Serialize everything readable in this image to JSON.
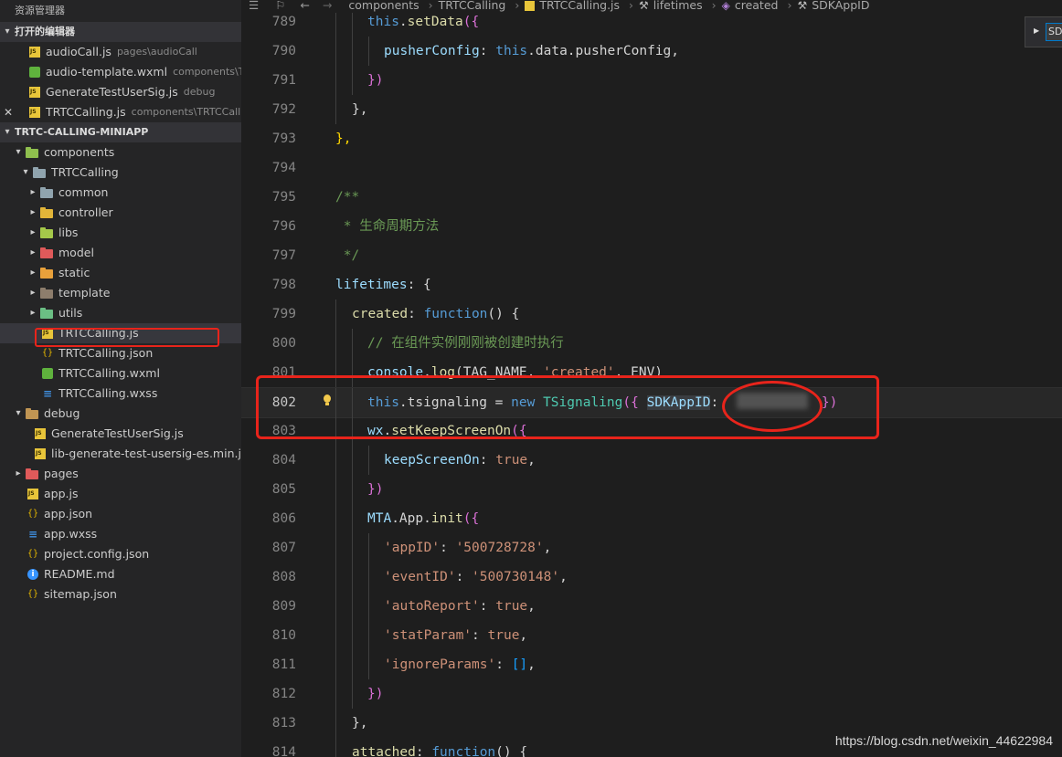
{
  "explorer": {
    "title": "资源管理器",
    "open_editors_label": "打开的编辑器",
    "open_editors": [
      {
        "name": "audioCall.js",
        "desc": "pages\\audioCall",
        "icon": "js-file-icon"
      },
      {
        "name": "audio-template.wxml",
        "desc": "components\\T...",
        "icon": "wxml-file-icon"
      },
      {
        "name": "GenerateTestUserSig.js",
        "desc": "debug",
        "icon": "js-file-icon"
      },
      {
        "name": "TRTCCalling.js",
        "desc": "components\\TRTCCalli...",
        "icon": "js-file-icon"
      }
    ],
    "close_glyph": "✕",
    "project_label": "TRTC-CALLING-MINIAPP",
    "tree": {
      "components": "components",
      "trtccalling": "TRTCCalling",
      "common": "common",
      "controller": "controller",
      "libs": "libs",
      "model": "model",
      "static": "static",
      "template": "template",
      "utils": "utils",
      "trtc_js": "TRTCCalling.js",
      "trtc_json": "TRTCCalling.json",
      "trtc_wxml": "TRTCCalling.wxml",
      "trtc_wxss": "TRTCCalling.wxss",
      "debug": "debug",
      "gen_sig": "GenerateTestUserSig.js",
      "lib_gen": "lib-generate-test-usersig-es.min.js",
      "pages": "pages",
      "app_js": "app.js",
      "app_json": "app.json",
      "app_wxss": "app.wxss",
      "project_config": "project.config.json",
      "readme": "README.md",
      "sitemap": "sitemap.json"
    }
  },
  "breadcrumb": {
    "items": [
      "components",
      "TRTCCalling",
      "TRTCCalling.js",
      "lifetimes",
      "created",
      "SDKAppID"
    ]
  },
  "find_widget": {
    "value": "SDK"
  },
  "editor": {
    "line_numbers": [
      "789",
      "790",
      "791",
      "792",
      "793",
      "794",
      "795",
      "796",
      "797",
      "798",
      "799",
      "800",
      "801",
      "802",
      "803",
      "804",
      "805",
      "806",
      "807",
      "808",
      "809",
      "810",
      "811",
      "812",
      "813",
      "814"
    ],
    "code": {
      "l789_a": "this",
      "l789_b": ".",
      "l789_c": "setData",
      "l789_d": "({",
      "l790_a": "pusherConfig",
      "l790_b": ": ",
      "l790_c": "this",
      "l790_d": ".data.pusherConfig,",
      "l791": "})",
      "l792": "},",
      "l793": "},",
      "l795": "/**",
      "l796": " * 生命周期方法",
      "l797": " */",
      "l798_a": "lifetimes",
      "l798_b": ": {",
      "l799_a": "created",
      "l799_b": ": ",
      "l799_c": "function",
      "l799_d": "() {",
      "l800": "// 在组件实例刚刚被创建时执行",
      "l801_a": "console",
      "l801_b": ".",
      "l801_c": "log",
      "l801_d": "(TAG_NAME, ",
      "l801_e": "'created'",
      "l801_f": ", ENV)",
      "l802_a": "this",
      "l802_b": ".tsignaling = ",
      "l802_c": "new",
      "l802_d": " ",
      "l802_e": "TSignaling",
      "l802_f": "({ ",
      "l802_g": "SDKAppID",
      "l802_h": ": ",
      "l802_i": "})",
      "l803_a": "wx",
      "l803_b": ".",
      "l803_c": "setKeepScreenOn",
      "l803_d": "({",
      "l804_a": "keepScreenOn",
      "l804_b": ": ",
      "l804_c": "true",
      "l804_d": ",",
      "l805": "})",
      "l806_a": "MTA",
      "l806_b": ".App.",
      "l806_c": "init",
      "l806_d": "({",
      "l807_a": "'appID'",
      "l807_b": ": ",
      "l807_c": "'500728728'",
      "l807_d": ",",
      "l808_a": "'eventID'",
      "l808_b": ": ",
      "l808_c": "'500730148'",
      "l808_d": ",",
      "l809_a": "'autoReport'",
      "l809_b": ": ",
      "l809_c": "true",
      "l809_d": ",",
      "l810_a": "'statParam'",
      "l810_b": ": ",
      "l810_c": "true",
      "l810_d": ",",
      "l811_a": "'ignoreParams'",
      "l811_b": ": ",
      "l811_c": "[]",
      "l811_d": ",",
      "l812": "})",
      "l813": "},",
      "l814_a": "attached",
      "l814_b": ": ",
      "l814_c": "function",
      "l814_d": "() {"
    }
  },
  "watermark": "https://blog.csdn.net/weixin_44622984",
  "colors": {
    "highlight_red": "#e8241b",
    "keyword": "#569cd6",
    "string": "#ce9178",
    "comment": "#6a9955"
  }
}
